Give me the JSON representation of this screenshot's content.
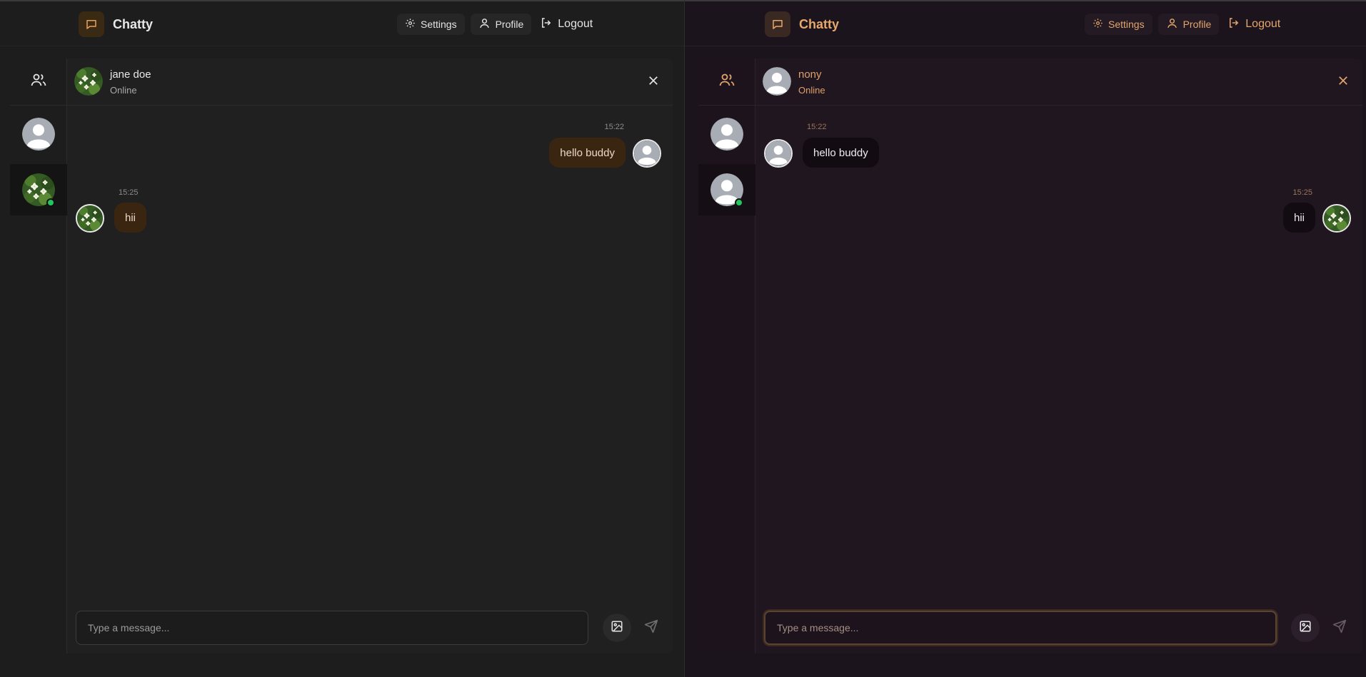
{
  "app": {
    "name": "Chatty"
  },
  "nav": {
    "settings": "Settings",
    "profile": "Profile",
    "logout": "Logout"
  },
  "composer": {
    "placeholder": "Type a message..."
  },
  "left": {
    "header": {
      "name": "jane doe",
      "status": "Online"
    },
    "messages": [
      {
        "time": "15:22",
        "text": "hello buddy",
        "direction": "sent"
      },
      {
        "time": "15:25",
        "text": "hii",
        "direction": "received"
      }
    ]
  },
  "right": {
    "header": {
      "name": "nony",
      "status": "Online"
    },
    "messages": [
      {
        "time": "15:22",
        "text": "hello buddy",
        "direction": "received"
      },
      {
        "time": "15:25",
        "text": "hii",
        "direction": "sent"
      }
    ]
  },
  "colors": {
    "accent": "#e8a15c",
    "online": "#22c55e",
    "left_bg": "#1d1d1d",
    "right_bg": "#1c141c"
  },
  "icons": [
    "chat-icon",
    "gear-icon",
    "user-icon",
    "logout-icon",
    "users-icon",
    "close-icon",
    "image-icon",
    "send-icon"
  ]
}
